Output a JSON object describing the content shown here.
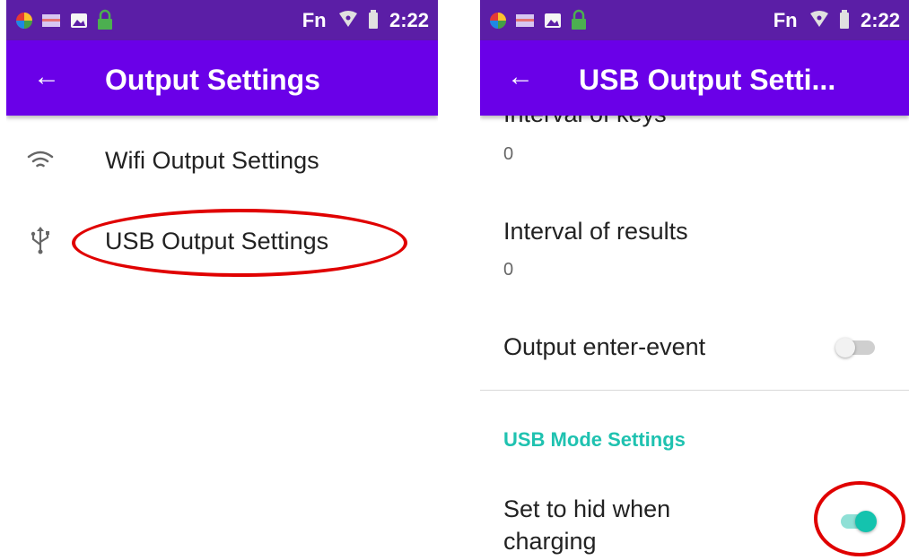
{
  "left": {
    "status_bar": {
      "label": "Fn",
      "time": "2:22"
    },
    "app_bar": {
      "back_icon": "←",
      "title": "Output Settings"
    },
    "items": [
      {
        "icon": "wifi-icon",
        "label": "Wifi Output Settings"
      },
      {
        "icon": "usb-icon",
        "label": "USB Output Settings"
      }
    ]
  },
  "right": {
    "status_bar": {
      "label": "Fn",
      "time": "2:22"
    },
    "app_bar": {
      "back_icon": "←",
      "title": "USB Output Setti..."
    },
    "prefs": {
      "cut_title": "Interval of keys",
      "cut_value": "0",
      "results_title": "Interval of results",
      "results_value": "0",
      "enter_event_title": "Output enter-event",
      "enter_event_on": false,
      "section_header": "USB Mode Settings",
      "hid_title_line1": "Set to hid when",
      "hid_title_line2": "charging",
      "hid_on": true
    }
  },
  "colors": {
    "status_bar": "#5b1ea6",
    "app_bar": "#6a00e8",
    "accent": "#14c3ae",
    "annotation": "#e00000"
  }
}
